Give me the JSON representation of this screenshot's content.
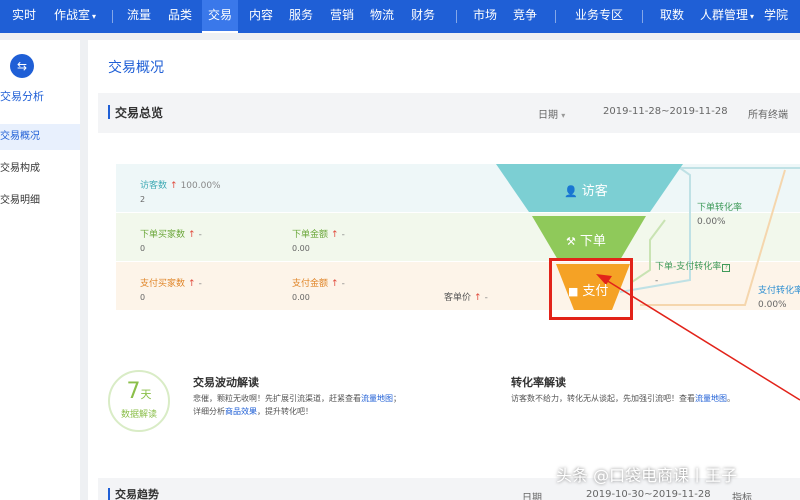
{
  "nav": {
    "items": [
      {
        "label": "实时"
      },
      {
        "label": "作战室"
      },
      {
        "label": "流量"
      },
      {
        "label": "品类"
      },
      {
        "label": "交易"
      },
      {
        "label": "内容"
      },
      {
        "label": "服务"
      },
      {
        "label": "营销"
      },
      {
        "label": "物流"
      },
      {
        "label": "财务"
      },
      {
        "label": "市场"
      },
      {
        "label": "竞争"
      },
      {
        "label": "业务专区"
      },
      {
        "label": "取数"
      },
      {
        "label": "人群管理"
      },
      {
        "label": "学院"
      }
    ],
    "active": "交易",
    "drop_glyph": "▾"
  },
  "sidebar": {
    "title": "交易分析",
    "items": [
      {
        "label": "交易概况"
      },
      {
        "label": "交易构成"
      },
      {
        "label": "交易明细"
      }
    ]
  },
  "page": {
    "title": "交易概况"
  },
  "overview": {
    "label": "交易总览",
    "date_label": "日期",
    "date_range": "2019-11-28~2019-11-28",
    "terminal": "所有终端"
  },
  "funnel": {
    "visitors": {
      "label": "访客数",
      "arrow": "↑",
      "pct": "100.00%",
      "value": "2"
    },
    "order_buyers": {
      "label": "下单买家数",
      "arrow": "↑",
      "pct": "-",
      "value": "0"
    },
    "order_amount": {
      "label": "下单金额",
      "arrow": "↑",
      "pct": "-",
      "value": "0.00"
    },
    "pay_buyers": {
      "label": "支付买家数",
      "arrow": "↑",
      "pct": "-",
      "value": "0"
    },
    "pay_amount": {
      "label": "支付金额",
      "arrow": "↑",
      "pct": "-",
      "value": "0.00"
    },
    "unit_price": {
      "label": "客单价",
      "arrow": "↑",
      "pct": "-"
    },
    "stage1": "访客",
    "stage2": "下单",
    "stage3": "支付",
    "conv_order": {
      "label": "下单转化率",
      "value": "0.00%"
    },
    "conv_order_pay": {
      "label": "下单-支付转化率",
      "value": "-"
    },
    "conv_pay": {
      "label": "支付转化率",
      "value": "0.00%"
    }
  },
  "insight": {
    "badge_num": "7",
    "badge_unit": "天",
    "badge_sub": "数据解读",
    "wave_title": "交易波动解读",
    "wave_text1": "悲催，颗粒无收啊！先扩展引流渠道，赶紧查看",
    "wave_link1": "流量地图",
    "wave_text2": "；详细分析",
    "wave_link2": "商品效果",
    "wave_text3": "，提升转化吧！",
    "conv_title": "转化率解读",
    "conv_text1": "访客数不给力，转化无从谈起，先加强引流吧！查看",
    "conv_link": "流量地图",
    "conv_text2": "。"
  },
  "trend": {
    "label": "交易趋势",
    "date_label": "日期",
    "date_range": "2019-10-30~2019-11-28",
    "metric": "指标"
  },
  "watermark": "头条 @口袋电商课丨王子",
  "colors": {
    "nav": "#1f5fd6",
    "visitor": "#7ccfd3",
    "order": "#8fc95a",
    "pay": "#f5a225",
    "highlight": "#e2231a"
  }
}
